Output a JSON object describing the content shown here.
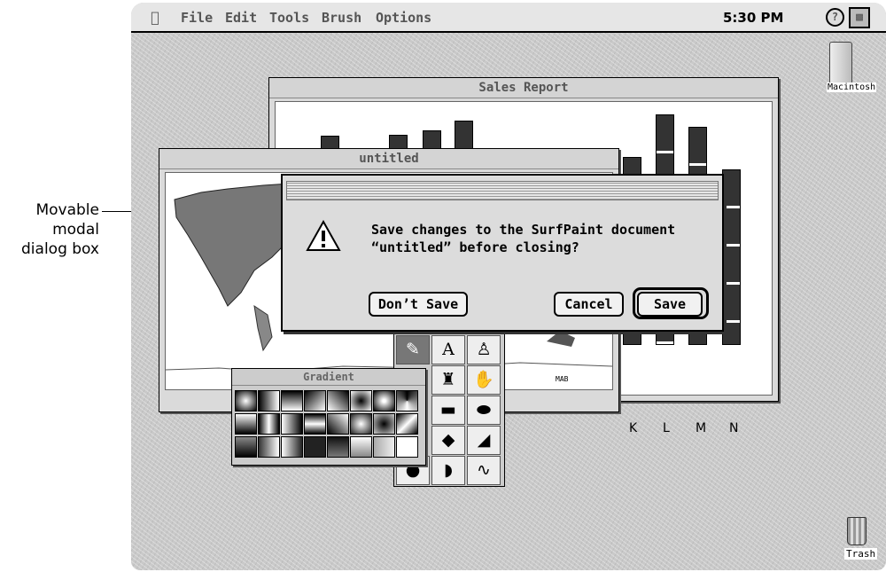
{
  "annotation": {
    "lines": [
      "Movable",
      "modal",
      "dialog box"
    ]
  },
  "menubar": {
    "items": [
      "File",
      "Edit",
      "Tools",
      "Brush",
      "Options"
    ],
    "clock": "5:30 PM",
    "apple_icon": "apple-icon",
    "help_icon": "?",
    "app_icon": "app-icon"
  },
  "desktop": {
    "disk_label": "Macintosh",
    "trash_label": "Trash"
  },
  "sales_window": {
    "title": "Sales Report",
    "x_labels": [
      "K",
      "L",
      "M",
      "N"
    ]
  },
  "untitled_window": {
    "title": "untitled",
    "map_label": "MAB"
  },
  "tool_palette": {
    "tools": [
      "pencil",
      "A",
      "bucket",
      "",
      "brush",
      "hand",
      "",
      "rounded-rect",
      "oval",
      "",
      "diamond",
      "polygon",
      "",
      "arc",
      "freeform"
    ]
  },
  "gradient_palette": {
    "title": "Gradient"
  },
  "dialog": {
    "message_line1": "Save changes to the SurfPaint document",
    "message_line2": "“untitled” before closing?",
    "dont_save": "Don’t Save",
    "cancel": "Cancel",
    "save": "Save"
  }
}
